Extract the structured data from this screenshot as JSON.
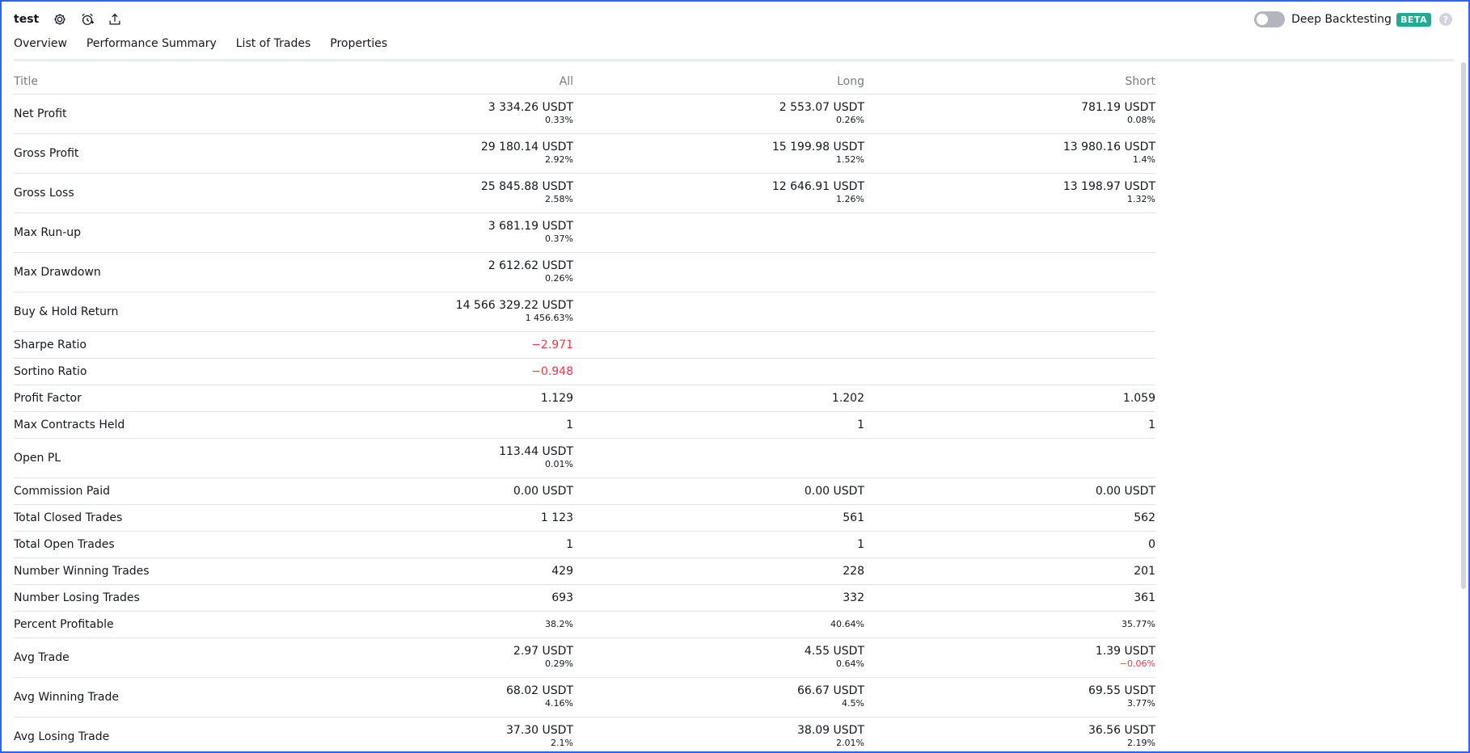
{
  "header": {
    "strategy_name": "test",
    "deep_backtesting_label": "Deep Backtesting",
    "beta_badge": "BETA",
    "help_glyph": "?"
  },
  "tabs": [
    {
      "label": "Overview",
      "active": false
    },
    {
      "label": "Performance Summary",
      "active": true
    },
    {
      "label": "List of Trades",
      "active": false
    },
    {
      "label": "Properties",
      "active": false
    }
  ],
  "table": {
    "columns": [
      "Title",
      "All",
      "Long",
      "Short"
    ],
    "rows": [
      {
        "title": "Net Profit",
        "all": "3 334.26 USDT",
        "all_sub": "0.33%",
        "long": "2 553.07 USDT",
        "long_sub": "0.26%",
        "short": "781.19 USDT",
        "short_sub": "0.08%"
      },
      {
        "title": "Gross Profit",
        "all": "29 180.14 USDT",
        "all_sub": "2.92%",
        "long": "15 199.98 USDT",
        "long_sub": "1.52%",
        "short": "13 980.16 USDT",
        "short_sub": "1.4%"
      },
      {
        "title": "Gross Loss",
        "all": "25 845.88 USDT",
        "all_sub": "2.58%",
        "long": "12 646.91 USDT",
        "long_sub": "1.26%",
        "short": "13 198.97 USDT",
        "short_sub": "1.32%"
      },
      {
        "title": "Max Run-up",
        "all": "3 681.19 USDT",
        "all_sub": "0.37%"
      },
      {
        "title": "Max Drawdown",
        "all": "2 612.62 USDT",
        "all_sub": "0.26%"
      },
      {
        "title": "Buy & Hold Return",
        "all": "14 566 329.22 USDT",
        "all_sub": "1 456.63%"
      },
      {
        "title": "Sharpe Ratio",
        "all": "−2.971"
      },
      {
        "title": "Sortino Ratio",
        "all": "−0.948"
      },
      {
        "title": "Profit Factor",
        "all": "1.129",
        "long": "1.202",
        "short": "1.059"
      },
      {
        "title": "Max Contracts Held",
        "all": "1",
        "long": "1",
        "short": "1"
      },
      {
        "title": "Open PL",
        "all": "113.44 USDT",
        "all_sub": "0.01%"
      },
      {
        "title": "Commission Paid",
        "all": "0.00 USDT",
        "long": "0.00 USDT",
        "short": "0.00 USDT"
      },
      {
        "title": "Total Closed Trades",
        "all": "1 123",
        "long": "561",
        "short": "562"
      },
      {
        "title": "Total Open Trades",
        "all": "1",
        "long": "1",
        "short": "0"
      },
      {
        "title": "Number Winning Trades",
        "all": "429",
        "long": "228",
        "short": "201"
      },
      {
        "title": "Number Losing Trades",
        "all": "693",
        "long": "332",
        "short": "361"
      },
      {
        "title": "Percent Profitable",
        "all": "38.2%",
        "long": "40.64%",
        "short": "35.77%"
      },
      {
        "title": "Avg Trade",
        "all": "2.97 USDT",
        "all_sub": "0.29%",
        "long": "4.55 USDT",
        "long_sub": "0.64%",
        "short": "1.39 USDT",
        "short_sub": "−0.06%"
      },
      {
        "title": "Avg Winning Trade",
        "all": "68.02 USDT",
        "all_sub": "4.16%",
        "long": "66.67 USDT",
        "long_sub": "4.5%",
        "short": "69.55 USDT",
        "short_sub": "3.77%"
      },
      {
        "title": "Avg Losing Trade",
        "all": "37.30 USDT",
        "all_sub": "2.1%",
        "long": "38.09 USDT",
        "long_sub": "2.01%",
        "short": "36.56 USDT",
        "short_sub": "2.19%"
      }
    ]
  },
  "colors": {
    "negative": "#f23645",
    "accent": "#2962ff",
    "beta_badge": "#22ab94",
    "muted": "#787b86"
  },
  "icons": [
    "gear-icon",
    "alarm-add-icon",
    "export-icon",
    "help-icon"
  ]
}
